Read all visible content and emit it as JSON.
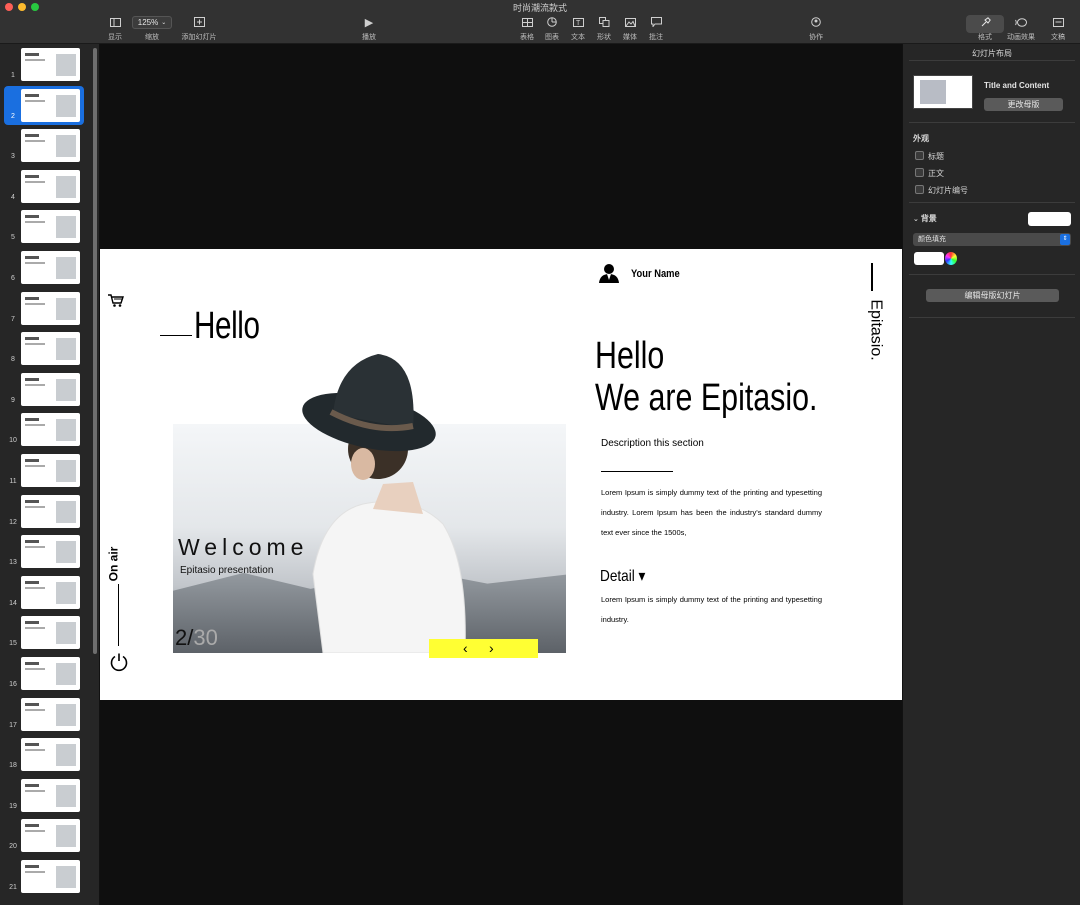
{
  "window": {
    "title": "时尚潮流款式"
  },
  "toolbar": {
    "view_label": "显示",
    "zoom_value": "125%",
    "zoom_label": "缩放",
    "add_slide_label": "添加幻灯片",
    "play_label": "播放",
    "table_label": "表格",
    "chart_label": "图表",
    "text_label": "文本",
    "shape_label": "形状",
    "media_label": "媒体",
    "comment_label": "批注",
    "collaborate_label": "协作",
    "format_label": "格式",
    "animate_label": "动画效果",
    "document_label": "文稿"
  },
  "sidebar": {
    "slide_numbers": [
      "1",
      "2",
      "3",
      "4",
      "5",
      "6",
      "7",
      "8",
      "9",
      "10",
      "11",
      "12",
      "13",
      "14",
      "15",
      "16",
      "17",
      "18",
      "19",
      "20",
      "21"
    ],
    "selected": "2"
  },
  "slide": {
    "hello_left": "Hello",
    "on_air": "On air",
    "welcome": "Welcome",
    "welcome_sub": "Epitasio presentation",
    "page_current": "2/",
    "page_total": "30",
    "your_name": "Your Name",
    "brand": "Epitasio.",
    "heading_line1": "Hello",
    "heading_line2": "We are Epitasio.",
    "description": "Description this section",
    "body": "Lorem Ipsum is simply dummy text of the printing and typesetting industry. Lorem Ipsum has been the industry's standard dummy text ever since the 1500s,",
    "detail": "Detail ▾",
    "body2": "Lorem Ipsum is simply dummy text of the printing and typesetting industry."
  },
  "inspector": {
    "title": "幻灯片布局",
    "layout_name": "Title and Content",
    "change_master": "更改母版",
    "appearance": "外观",
    "opt_title": "标题",
    "opt_body": "正文",
    "opt_slide_number": "幻灯片编号",
    "background": "背景",
    "fill_type": "颜色填充",
    "edit_master": "编辑母版幻灯片"
  },
  "colors": {
    "accent": "#1a6fe0",
    "highlight": "#ffff33"
  }
}
